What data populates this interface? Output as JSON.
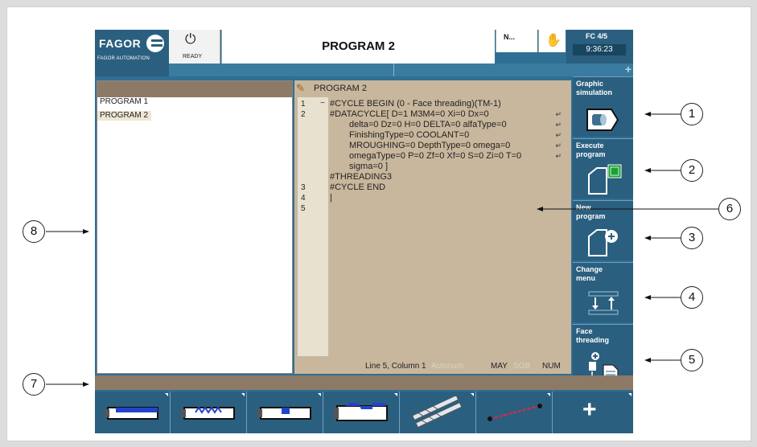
{
  "header": {
    "brand": "FAGOR",
    "brand_sub": "FAGOR AUTOMATION",
    "status_label": "READY",
    "program_title": "PROGRAM 2",
    "mode": "N...",
    "fc": "FC 4/5",
    "clock": "9:36:23"
  },
  "program_list": {
    "items": [
      "PROGRAM 1",
      "PROGRAM 2"
    ],
    "selected": "PROGRAM 2"
  },
  "editor": {
    "title": "PROGRAM 2",
    "line_numbers": [
      "1",
      "2",
      "3",
      "4",
      "5"
    ],
    "lines": [
      "#CYCLE BEGIN (0 - Face threading)(TM-1)",
      "#DATACYCLE[ D=1 M3M4=0 Xi=0 Dx=0",
      "delta=0 Dz=0 H=0 DELTA=0 alfaType=0",
      "FinishingType=0 COOLANT=0",
      "MROUGHING=0 DepthType=0 omega=0",
      "omegaType=0 P=0 Zf=0 Xf=0 S=0 Zi=0 T=0",
      "sigma=0 ]",
      "#THREADING3",
      "#CYCLE END",
      "|"
    ],
    "wrap_mark": "↵",
    "status": {
      "position": "Line 5, Column 1",
      "autonum": "Autonum",
      "may": "MAY",
      "sob": "SOB",
      "num": "NUM"
    }
  },
  "softkeys": [
    {
      "label_1": "Graphic",
      "label_2": "simulation",
      "icon": "graphic-simulation-icon"
    },
    {
      "label_1": "Execute",
      "label_2": "program",
      "icon": "execute-program-icon"
    },
    {
      "label_1": "New",
      "label_2": "program",
      "icon": "new-program-icon"
    },
    {
      "label_1": "Change",
      "label_2": "menu",
      "icon": "change-menu-icon"
    },
    {
      "label_1": "Face",
      "label_2": "threading",
      "icon": "face-threading-icon"
    }
  ],
  "horizontal_softkeys": [
    {
      "icon": "turning-cycle-icon"
    },
    {
      "icon": "threading-cycle-icon"
    },
    {
      "icon": "grooving-cycle-icon"
    },
    {
      "icon": "profile-cycle-icon"
    },
    {
      "icon": "drilling-tools-icon"
    },
    {
      "icon": "positioning-line-icon"
    },
    {
      "icon": "plus-icon"
    }
  ],
  "callouts": [
    "1",
    "2",
    "3",
    "4",
    "5",
    "6",
    "7",
    "8"
  ],
  "colors": {
    "panel_blue": "#2b5f7f",
    "editor_bg": "#c8b79d",
    "bar_brown": "#8c7a67",
    "status_disabled": "#d8ccb6"
  }
}
